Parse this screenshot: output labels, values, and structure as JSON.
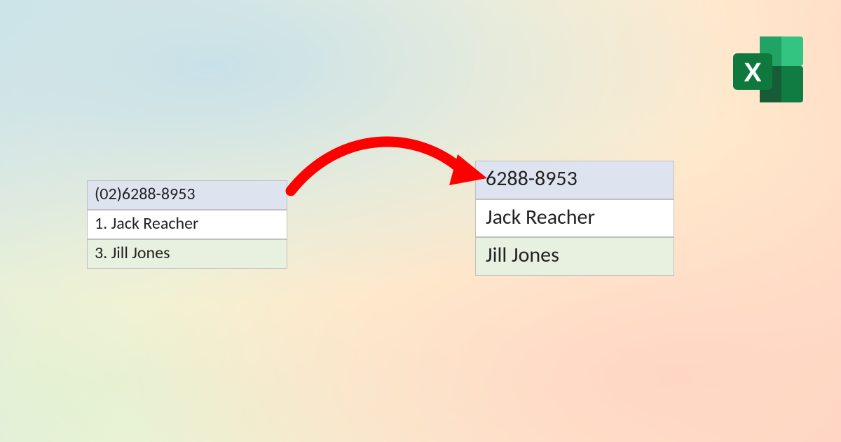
{
  "left_table": {
    "rows": [
      "(02)6288-8953",
      "1. Jack Reacher",
      "3. Jill Jones"
    ]
  },
  "right_table": {
    "rows": [
      "6288-8953",
      "Jack Reacher",
      "Jill Jones"
    ]
  },
  "icon": {
    "letter": "X"
  }
}
